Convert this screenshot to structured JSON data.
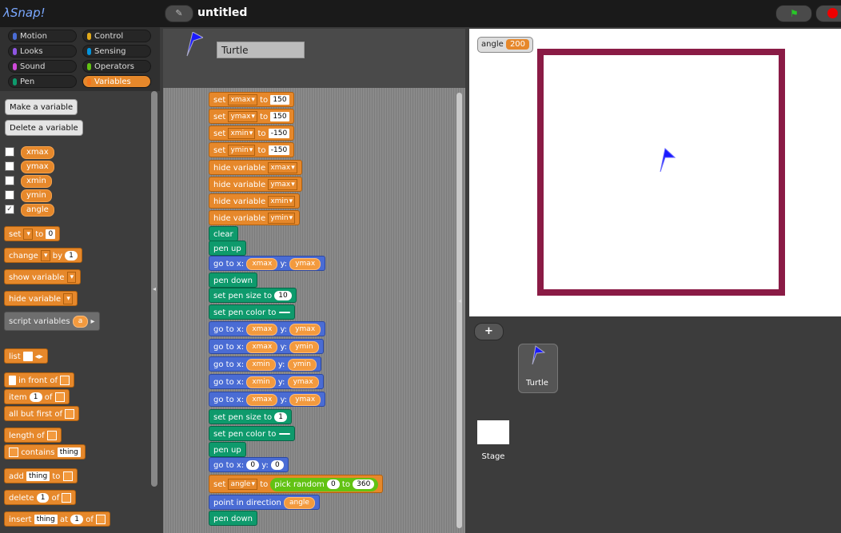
{
  "app": {
    "logo": "λSnap!",
    "project_title": "untitled"
  },
  "categories": [
    {
      "label": "Motion",
      "color": "#4a6cd4"
    },
    {
      "label": "Control",
      "color": "#e1a91a"
    },
    {
      "label": "Looks",
      "color": "#8f56e3"
    },
    {
      "label": "Sensing",
      "color": "#0494dc"
    },
    {
      "label": "Sound",
      "color": "#cf4ad9"
    },
    {
      "label": "Operators",
      "color": "#62c213"
    },
    {
      "label": "Pen",
      "color": "#0e9a6c"
    },
    {
      "label": "Variables",
      "color": "#f3761d"
    }
  ],
  "palette": {
    "make_variable": "Make a variable",
    "delete_variable": "Delete a variable",
    "variables": [
      {
        "name": "xmax",
        "checked": false
      },
      {
        "name": "ymax",
        "checked": false
      },
      {
        "name": "xmin",
        "checked": false
      },
      {
        "name": "ymin",
        "checked": false
      },
      {
        "name": "angle",
        "checked": true
      }
    ],
    "set_label": "set",
    "set_to": "to",
    "set_value": "0",
    "change_label": "change",
    "change_by": "by",
    "change_value": "1",
    "show_variable": "show variable",
    "hide_variable": "hide variable",
    "script_variables": "script variables",
    "script_var_a": "a",
    "list_label": "list",
    "in_front_of": "in front of",
    "item_label": "item",
    "item_val": "1",
    "item_of": "of",
    "all_but_first": "all but first of",
    "length_of": "length of",
    "contains": "contains",
    "contains_thing": "thing",
    "add_label": "add",
    "add_thing": "thing",
    "add_to": "to",
    "delete_label": "delete",
    "delete_val": "1",
    "delete_of": "of",
    "insert_label": "insert",
    "insert_thing": "thing",
    "insert_at": "at",
    "insert_val": "1",
    "insert_of": "of"
  },
  "sprite": {
    "name": "Turtle"
  },
  "script": {
    "set": "set",
    "to": "to",
    "hide_variable": "hide variable",
    "clear": "clear",
    "pen_up": "pen up",
    "pen_down": "pen down",
    "go_to_x": "go to x:",
    "y": "y:",
    "set_pen_size_to": "set pen size to",
    "set_pen_color_to": "set pen color to",
    "pick_random": "pick random",
    "point_in_direction": "point in direction",
    "set_rows": [
      {
        "var": "xmax",
        "value": "150"
      },
      {
        "var": "ymax",
        "value": "150"
      },
      {
        "var": "xmin",
        "value": "-150"
      },
      {
        "var": "ymin",
        "value": "-150"
      }
    ],
    "hide_vars": [
      "xmax",
      "ymax",
      "xmin",
      "ymin"
    ],
    "goto_first": {
      "x": "xmax",
      "y": "ymax"
    },
    "pen_size_1": "10",
    "pen_color_1": "#8a1b45",
    "goto_rows": [
      {
        "x": "xmax",
        "y": "ymax"
      },
      {
        "x": "xmax",
        "y": "ymin"
      },
      {
        "x": "xmin",
        "y": "ymin"
      },
      {
        "x": "xmin",
        "y": "ymax"
      },
      {
        "x": "xmax",
        "y": "ymax"
      }
    ],
    "pen_size_2": "1",
    "pen_color_2": "#1a1aff",
    "goto_origin": {
      "x": "0",
      "y": "0"
    },
    "random_var": "angle",
    "random_from": "0",
    "random_to": "360",
    "direction_var": "angle"
  },
  "stage": {
    "watcher_label": "angle",
    "watcher_value": "200",
    "square_color": "#8a1b45",
    "turtle_color": "#1a1aff"
  },
  "corral": {
    "sprite_label": "Turtle",
    "stage_label": "Stage"
  }
}
